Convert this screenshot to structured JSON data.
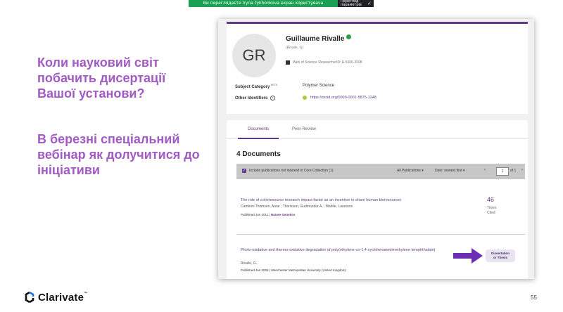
{
  "share_bar": {
    "text": "Ви переглядаєте Iryna Tykhonkova екран користувача",
    "button_label": "Перегляд параметрів",
    "check_icon": "✓"
  },
  "slide": {
    "title": "Коли науковий світ побачить дисертації Вашої установи?",
    "subtitle": "В березні спеціальний вебінар як долучитися до ініціативи",
    "logo_text": "Clarivate",
    "logo_tm": "™",
    "page_number": "55"
  },
  "profile": {
    "initials": "GR",
    "name": "Guillaume Rivalle",
    "alias": "(Rivalle, G)",
    "researcher_id": "Web of Science ResearcherID: A-5606-2008",
    "subject_category_label": "Subject Category",
    "beta_label": "BETA",
    "subject_category_value": "Polymer Science",
    "other_identifiers_label": "Other Identifiers",
    "info_icon": "i",
    "orcid_url": "https://orcid.org/0000-0001-5875-1248"
  },
  "documents": {
    "tabs": [
      {
        "label": "Documents",
        "active": true
      },
      {
        "label": "Peer Review",
        "active": false
      }
    ],
    "count_title": "4 Documents",
    "filter": {
      "checkbox_icon": "✓",
      "include_label": "Include publications not indexed in Core Collection (1)",
      "publications_select": "All Publications ▾",
      "sort_select": "Date: newest first ▾",
      "prev": "‹",
      "page_value": "1",
      "page_of": "of 1",
      "next": "›"
    },
    "items": [
      {
        "title": "The role of a bioresource research impact factor as an incentive to share human bioresources",
        "authors": "Cambon-Thomsen, Anne ; Thorisson, Gudmundur A. ; Mabile, Laurence",
        "published_prefix": "Published Jun 2011 |",
        "venue": "Nature Genetics",
        "times_cited": "46",
        "times_cited_label": "Times Cited"
      },
      {
        "title": "Photo-oxidative and thermo-oxidative degradation of poly(ethylene-co-1,4-cyclohexanedimethylene terephthalate)",
        "authors": "Rivalle, G.",
        "published_prefix": "Published Jan 2006 |",
        "venue": "Manchester Metropolitan University (United Kingdom)",
        "badge_line1": "Dissertation",
        "badge_line2": "or Thesis"
      }
    ]
  },
  "colors": {
    "accent": "#5e3b87",
    "heading": "#a25ac4",
    "share_green": "#1aa152"
  }
}
